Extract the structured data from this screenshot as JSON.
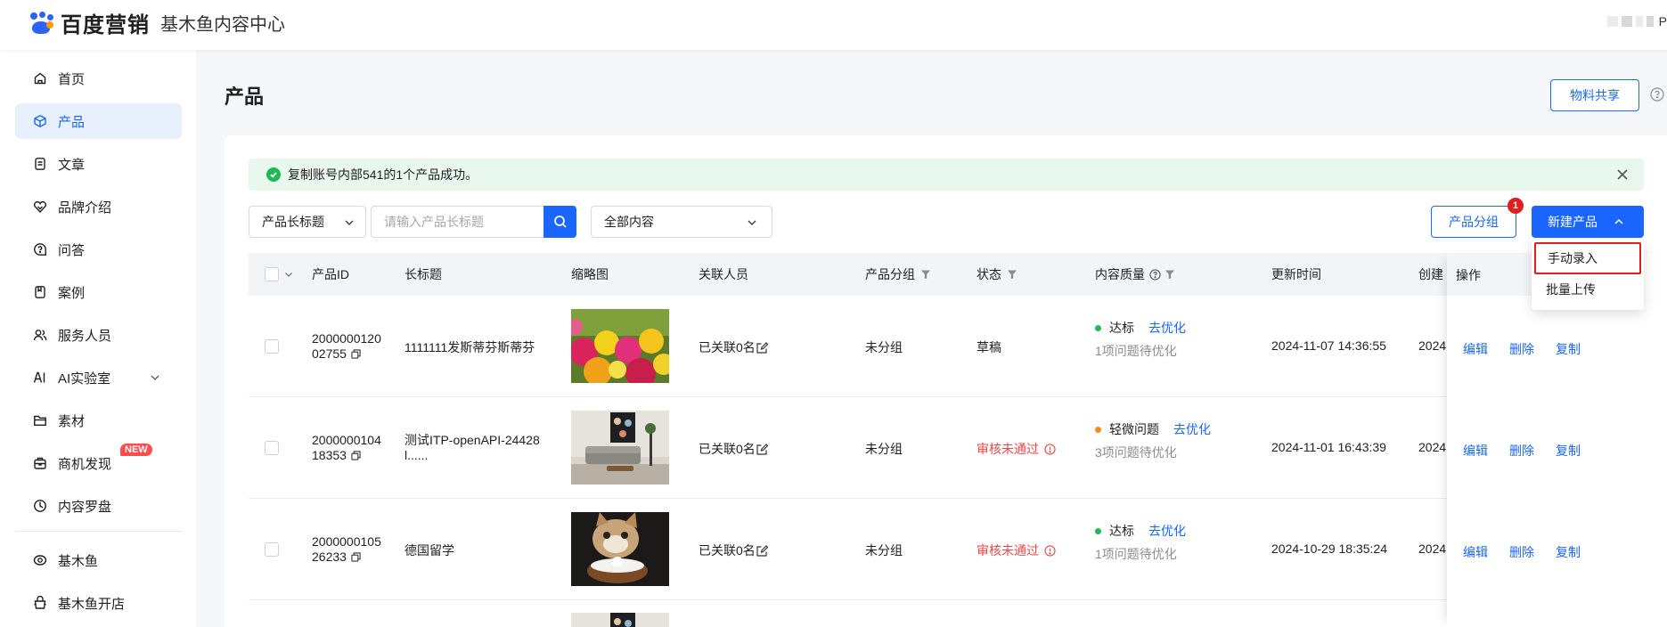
{
  "header": {
    "brand": "百度营销",
    "subtitle": "基木鱼内容中心",
    "user_initial": "P"
  },
  "sidebar": {
    "items": [
      {
        "label": "首页",
        "icon": "home-icon"
      },
      {
        "label": "产品",
        "icon": "product-box-icon",
        "active": true
      },
      {
        "label": "文章",
        "icon": "document-icon"
      },
      {
        "label": "品牌介绍",
        "icon": "brand-heart-icon"
      },
      {
        "label": "问答",
        "icon": "question-bubble-icon"
      },
      {
        "label": "案例",
        "icon": "case-book-icon"
      },
      {
        "label": "服务人员",
        "icon": "people-icon"
      },
      {
        "label": "AI实验室",
        "icon": "ai-icon",
        "expandable": true
      },
      {
        "label": "素材",
        "icon": "folder-icon"
      },
      {
        "label": "商机发现",
        "icon": "briefcase-icon",
        "badge": "NEW"
      },
      {
        "label": "内容罗盘",
        "icon": "compass-icon"
      }
    ],
    "bottom_items": [
      {
        "label": "基木鱼",
        "icon": "fish-eye-icon"
      },
      {
        "label": "基木鱼开店",
        "icon": "store-icon"
      }
    ]
  },
  "page": {
    "title": "产品",
    "share_button": "物料共享"
  },
  "alert": {
    "message": "复制账号内部541的1个产品成功。"
  },
  "filters": {
    "field_select": "产品长标题",
    "search_placeholder": "请输入产品长标题",
    "scope_select": "全部内容",
    "group_button": "产品分组",
    "new_button": "新建产品",
    "new_badge_count": "1"
  },
  "dropdown": {
    "items": [
      "手动录入",
      "批量上传"
    ]
  },
  "table": {
    "columns": {
      "id": "产品ID",
      "title": "长标题",
      "thumb": "缩略图",
      "related": "关联人员",
      "group": "产品分组",
      "status": "状态",
      "quality": "内容质量",
      "updated": "更新时间",
      "created": "创建",
      "ops": "操作"
    },
    "rows": [
      {
        "id_line1": "2000000120",
        "id_line2": "02755",
        "title": "1111111发斯蒂芬斯蒂芬",
        "thumb": "flowers",
        "related": "已关联0名",
        "group": "未分组",
        "status": "草稿",
        "status_color": "#1f1f1f",
        "quality_level": "达标",
        "quality_dot": "#1db954",
        "quality_action": "去优化",
        "quality_sub": "1项问题待优化",
        "updated": "2024-11-07 14:36:55",
        "created": "2024",
        "ops": [
          "编辑",
          "删除",
          "复制"
        ]
      },
      {
        "id_line1": "2000000104",
        "id_line2": "18353",
        "title_line1": "测试ITP-openAPI-24428",
        "title_line2": "l......",
        "thumb": "living-room",
        "related": "已关联0名",
        "group": "未分组",
        "status": "审核未通过",
        "status_color": "#f04646",
        "quality_level": "轻微问题",
        "quality_dot": "#fa8c16",
        "quality_action": "去优化",
        "quality_sub": "3项问题待优化",
        "updated": "2024-11-01 16:43:39",
        "created": "2024",
        "ops": [
          "编辑",
          "删除",
          "复制"
        ]
      },
      {
        "id_line1": "2000000105",
        "id_line2": "26233",
        "title": "德国留学",
        "thumb": "kitten",
        "related": "已关联0名",
        "group": "未分组",
        "status": "审核未通过",
        "status_color": "#f04646",
        "quality_level": "达标",
        "quality_dot": "#1db954",
        "quality_action": "去优化",
        "quality_sub": "1项问题待优化",
        "updated": "2024-10-29 18:35:24",
        "created": "2024",
        "ops": [
          "编辑",
          "删除",
          "复制"
        ]
      }
    ]
  },
  "colors": {
    "primary": "#1a66ff",
    "danger": "#f04646",
    "success": "#1db954",
    "warning": "#fa8c16"
  }
}
